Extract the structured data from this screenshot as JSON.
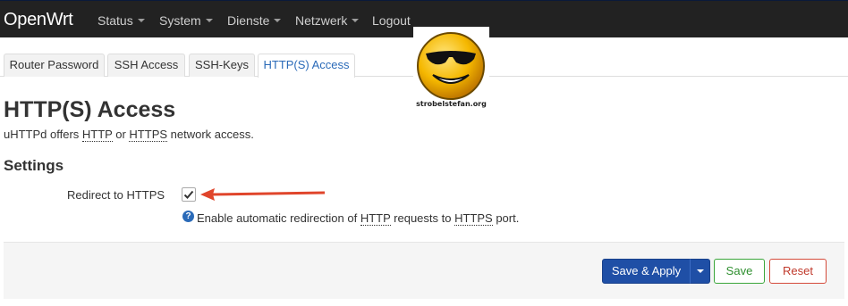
{
  "header": {
    "brand": "OpenWrt",
    "menu": [
      {
        "label": "Status",
        "has_caret": true
      },
      {
        "label": "System",
        "has_caret": true
      },
      {
        "label": "Dienste",
        "has_caret": true
      },
      {
        "label": "Netzwerk",
        "has_caret": true
      },
      {
        "label": "Logout",
        "has_caret": false
      }
    ]
  },
  "tabs": [
    {
      "label": "Router Password",
      "active": false
    },
    {
      "label": "SSH Access",
      "active": false
    },
    {
      "label": "SSH-Keys",
      "active": false
    },
    {
      "label": "HTTP(S) Access",
      "active": true
    }
  ],
  "watermark": {
    "caption": "strobelstefan.org"
  },
  "page": {
    "title": "HTTP(S) Access",
    "description": {
      "part1": "uHTTPd offers ",
      "http": "HTTP",
      "part2": " or ",
      "https": "HTTPS",
      "part3": " network access."
    },
    "section_title": "Settings"
  },
  "settings": {
    "redirect_label": "Redirect to HTTPS",
    "redirect_checked": true,
    "help_icon": "?",
    "help": {
      "part1": "Enable automatic redirection of ",
      "http": "HTTP",
      "part2": " requests to ",
      "https": "HTTPS",
      "part3": " port."
    }
  },
  "actions": {
    "save_apply": "Save & Apply",
    "save": "Save",
    "reset": "Reset"
  },
  "colors": {
    "navbar": "#222222",
    "primary": "#1f4fa6",
    "save": "#3aa63a",
    "reset": "#d44a3a",
    "arrow": "#e0452b"
  }
}
